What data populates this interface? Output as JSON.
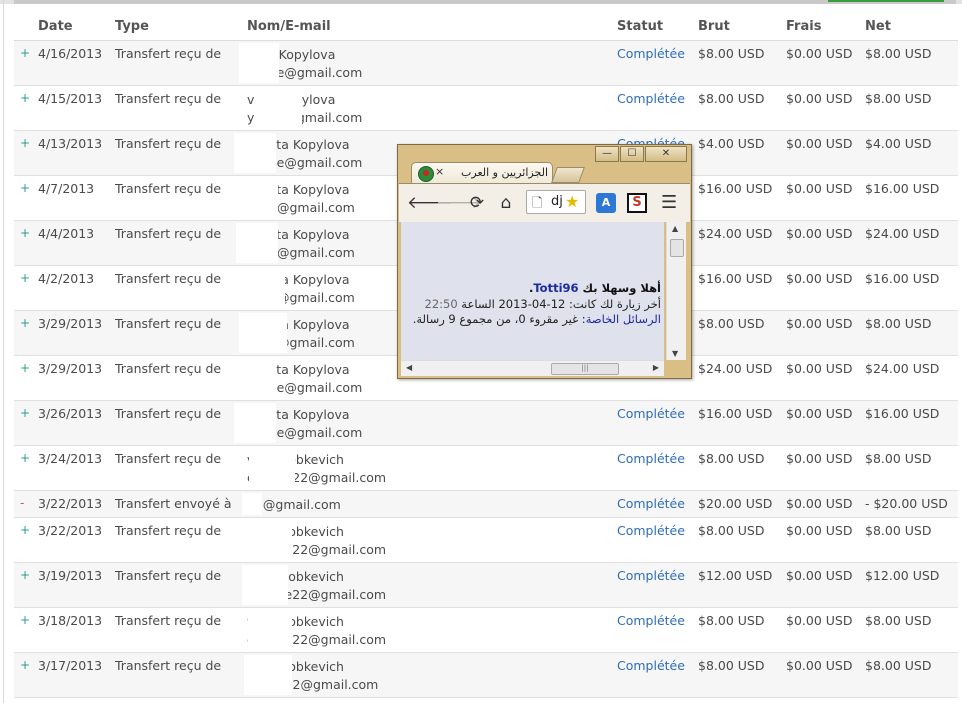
{
  "headers": {
    "date": "Date",
    "type": "Type",
    "name": "Nom/E-mail",
    "status": "Statut",
    "gross": "Brut",
    "fee": "Frais",
    "net": "Net"
  },
  "rows": [
    {
      "sign": "+",
      "date": "4/16/2013",
      "type": "Transfert reçu de",
      "name": "veta Kopylova",
      "email": "ystyle@gmail.com",
      "status": "Complétée",
      "gross": "$8.00 USD",
      "fee": "$0.00 USD",
      "net": "$8.00 USD"
    },
    {
      "sign": "+",
      "date": "4/15/2013",
      "type": "Transfert reçu de",
      "name": "veta Kopylova",
      "email": "ystyle@gmail.com",
      "status": "Complétée",
      "gross": "$8.00 USD",
      "fee": "$0.00 USD",
      "net": "$8.00 USD"
    },
    {
      "sign": "+",
      "date": "4/13/2013",
      "type": "Transfert reçu de",
      "name": "zaveta Kopylova",
      "email": "ystyle@gmail.com",
      "status": "Complétée",
      "gross": "$4.00 USD",
      "fee": "$0.00 USD",
      "net": "$4.00 USD"
    },
    {
      "sign": "+",
      "date": "4/7/2013",
      "type": "Transfert reçu de",
      "name": "zaveta Kopylova",
      "email": "style@gmail.com",
      "status": "",
      "gross": "$16.00 USD",
      "fee": "$0.00 USD",
      "net": "$16.00 USD"
    },
    {
      "sign": "+",
      "date": "4/4/2013",
      "type": "Transfert reçu de",
      "name": "zaveta Kopylova",
      "email": "style@gmail.com",
      "status": "",
      "gross": "$24.00 USD",
      "fee": "$0.00 USD",
      "net": "$24.00 USD"
    },
    {
      "sign": "+",
      "date": "4/2/2013",
      "type": "Transfert reçu de",
      "name": "zaveta Kopylova",
      "email": "style@gmail.com",
      "status": "",
      "gross": "$16.00 USD",
      "fee": "$0.00 USD",
      "net": "$16.00 USD"
    },
    {
      "sign": "+",
      "date": "3/29/2013",
      "type": "Transfert reçu de",
      "name": "zaveta Kopylova",
      "email": "style@gmail.com",
      "status": "",
      "gross": "$8.00 USD",
      "fee": "$0.00 USD",
      "net": "$8.00 USD"
    },
    {
      "sign": "+",
      "date": "3/29/2013",
      "type": "Transfert reçu de",
      "name": "zaveta Kopylova",
      "email": "ystyle@gmail.com",
      "status": "",
      "gross": "$24.00 USD",
      "fee": "$0.00 USD",
      "net": "$24.00 USD"
    },
    {
      "sign": "+",
      "date": "3/26/2013",
      "type": "Transfert reçu de",
      "name": "zaveta Kopylova",
      "email": "ystyle@gmail.com",
      "status": "Complétée",
      "gross": "$16.00 USD",
      "fee": "$0.00 USD",
      "net": "$16.00 USD"
    },
    {
      "sign": "+",
      "date": "3/24/2013",
      "type": "Transfert reçu de",
      "name": "veta Dobkevich",
      "email": "emorte22@gmail.com",
      "status": "Complétée",
      "gross": "$8.00 USD",
      "fee": "$0.00 USD",
      "net": "$8.00 USD"
    },
    {
      "sign": "-",
      "date": "3/22/2013",
      "type": "Transfert envoyé à",
      "name": "88@gmail.com",
      "email": "",
      "status": "Complétée",
      "gross": "$20.00 USD",
      "fee": "$0.00 USD",
      "net": "- $20.00 USD"
    },
    {
      "sign": "+",
      "date": "3/22/2013",
      "type": "Transfert reçu de",
      "name": "veta Dobkevich",
      "email": "emorte22@gmail.com",
      "status": "Complétée",
      "gross": "$8.00 USD",
      "fee": "$0.00 USD",
      "net": "$8.00 USD"
    },
    {
      "sign": "+",
      "date": "3/19/2013",
      "type": "Transfert reçu de",
      "name": "veta Dobkevich",
      "email": "emorte22@gmail.com",
      "status": "Complétée",
      "gross": "$12.00 USD",
      "fee": "$0.00 USD",
      "net": "$12.00 USD"
    },
    {
      "sign": "+",
      "date": "3/18/2013",
      "type": "Transfert reçu de",
      "name": "veta Dobkevich",
      "email": "emorte22@gmail.com",
      "status": "Complétée",
      "gross": "$8.00 USD",
      "fee": "$0.00 USD",
      "net": "$8.00 USD"
    },
    {
      "sign": "+",
      "date": "3/17/2013",
      "type": "Transfert reçu de",
      "name": "veta Dobkevich",
      "email": "morte22@gmail.com",
      "status": "Complétée",
      "gross": "$8.00 USD",
      "fee": "$0.00 USD",
      "net": "$8.00 USD"
    }
  ],
  "popup": {
    "tab_title": "الجزائريين و العرب",
    "tab_close": "×",
    "omnibox_text": "dj",
    "icons": {
      "back": "back-arrow-icon",
      "forward": "forward-arrow-icon",
      "reload": "reload-icon",
      "home": "home-icon",
      "page": "page-icon",
      "star": "star-icon",
      "translate": "translate-icon",
      "ext": "extension-icon",
      "menu": "menu-icon"
    },
    "window_controls": {
      "minimize": "—",
      "maximize": "☐",
      "close": "✕"
    },
    "welcome_prefix": "أهلا وسهلا بك ",
    "username": "Totti96",
    "welcome_suffix": ".",
    "last_visit_prefix": "أخر زيارة لك كانت: 12-04-2013 الساعة ",
    "last_visit_time": "22:50",
    "pm_link": "الرسائل الخاصة",
    "pm_text": ": غير مقروء 0، من مجموع 9 رسالة."
  },
  "colors": {
    "status_link": "#2f6db5",
    "accent_green": "#3d9a3d",
    "window_frame": "#d9bf86"
  }
}
